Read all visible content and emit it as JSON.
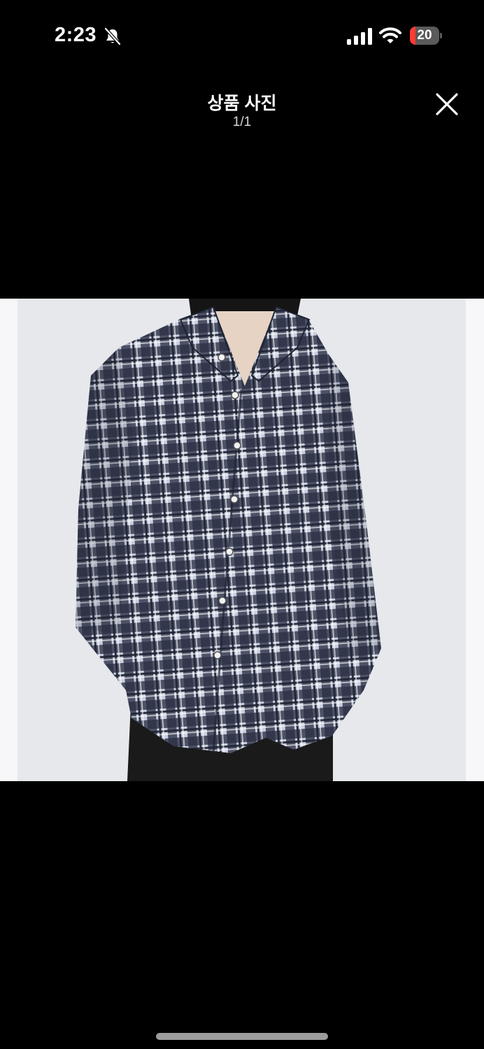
{
  "status": {
    "time": "2:23",
    "battery_level": "20",
    "battery_fraction": 0.2,
    "icons": [
      "bell-slash-icon",
      "cellular-signal-icon",
      "wifi-icon",
      "battery-icon"
    ]
  },
  "header": {
    "title": "상품 사진",
    "counter": "1/1",
    "close_icon": "close-icon"
  },
  "photo": {
    "subject": "plaid-shirt-product-photo",
    "colors": {
      "background": "#e7e8ec",
      "shirt_dark": "#1e2333",
      "shirt_light": "#c9cfdf",
      "pants": "#1a1a1a"
    }
  }
}
